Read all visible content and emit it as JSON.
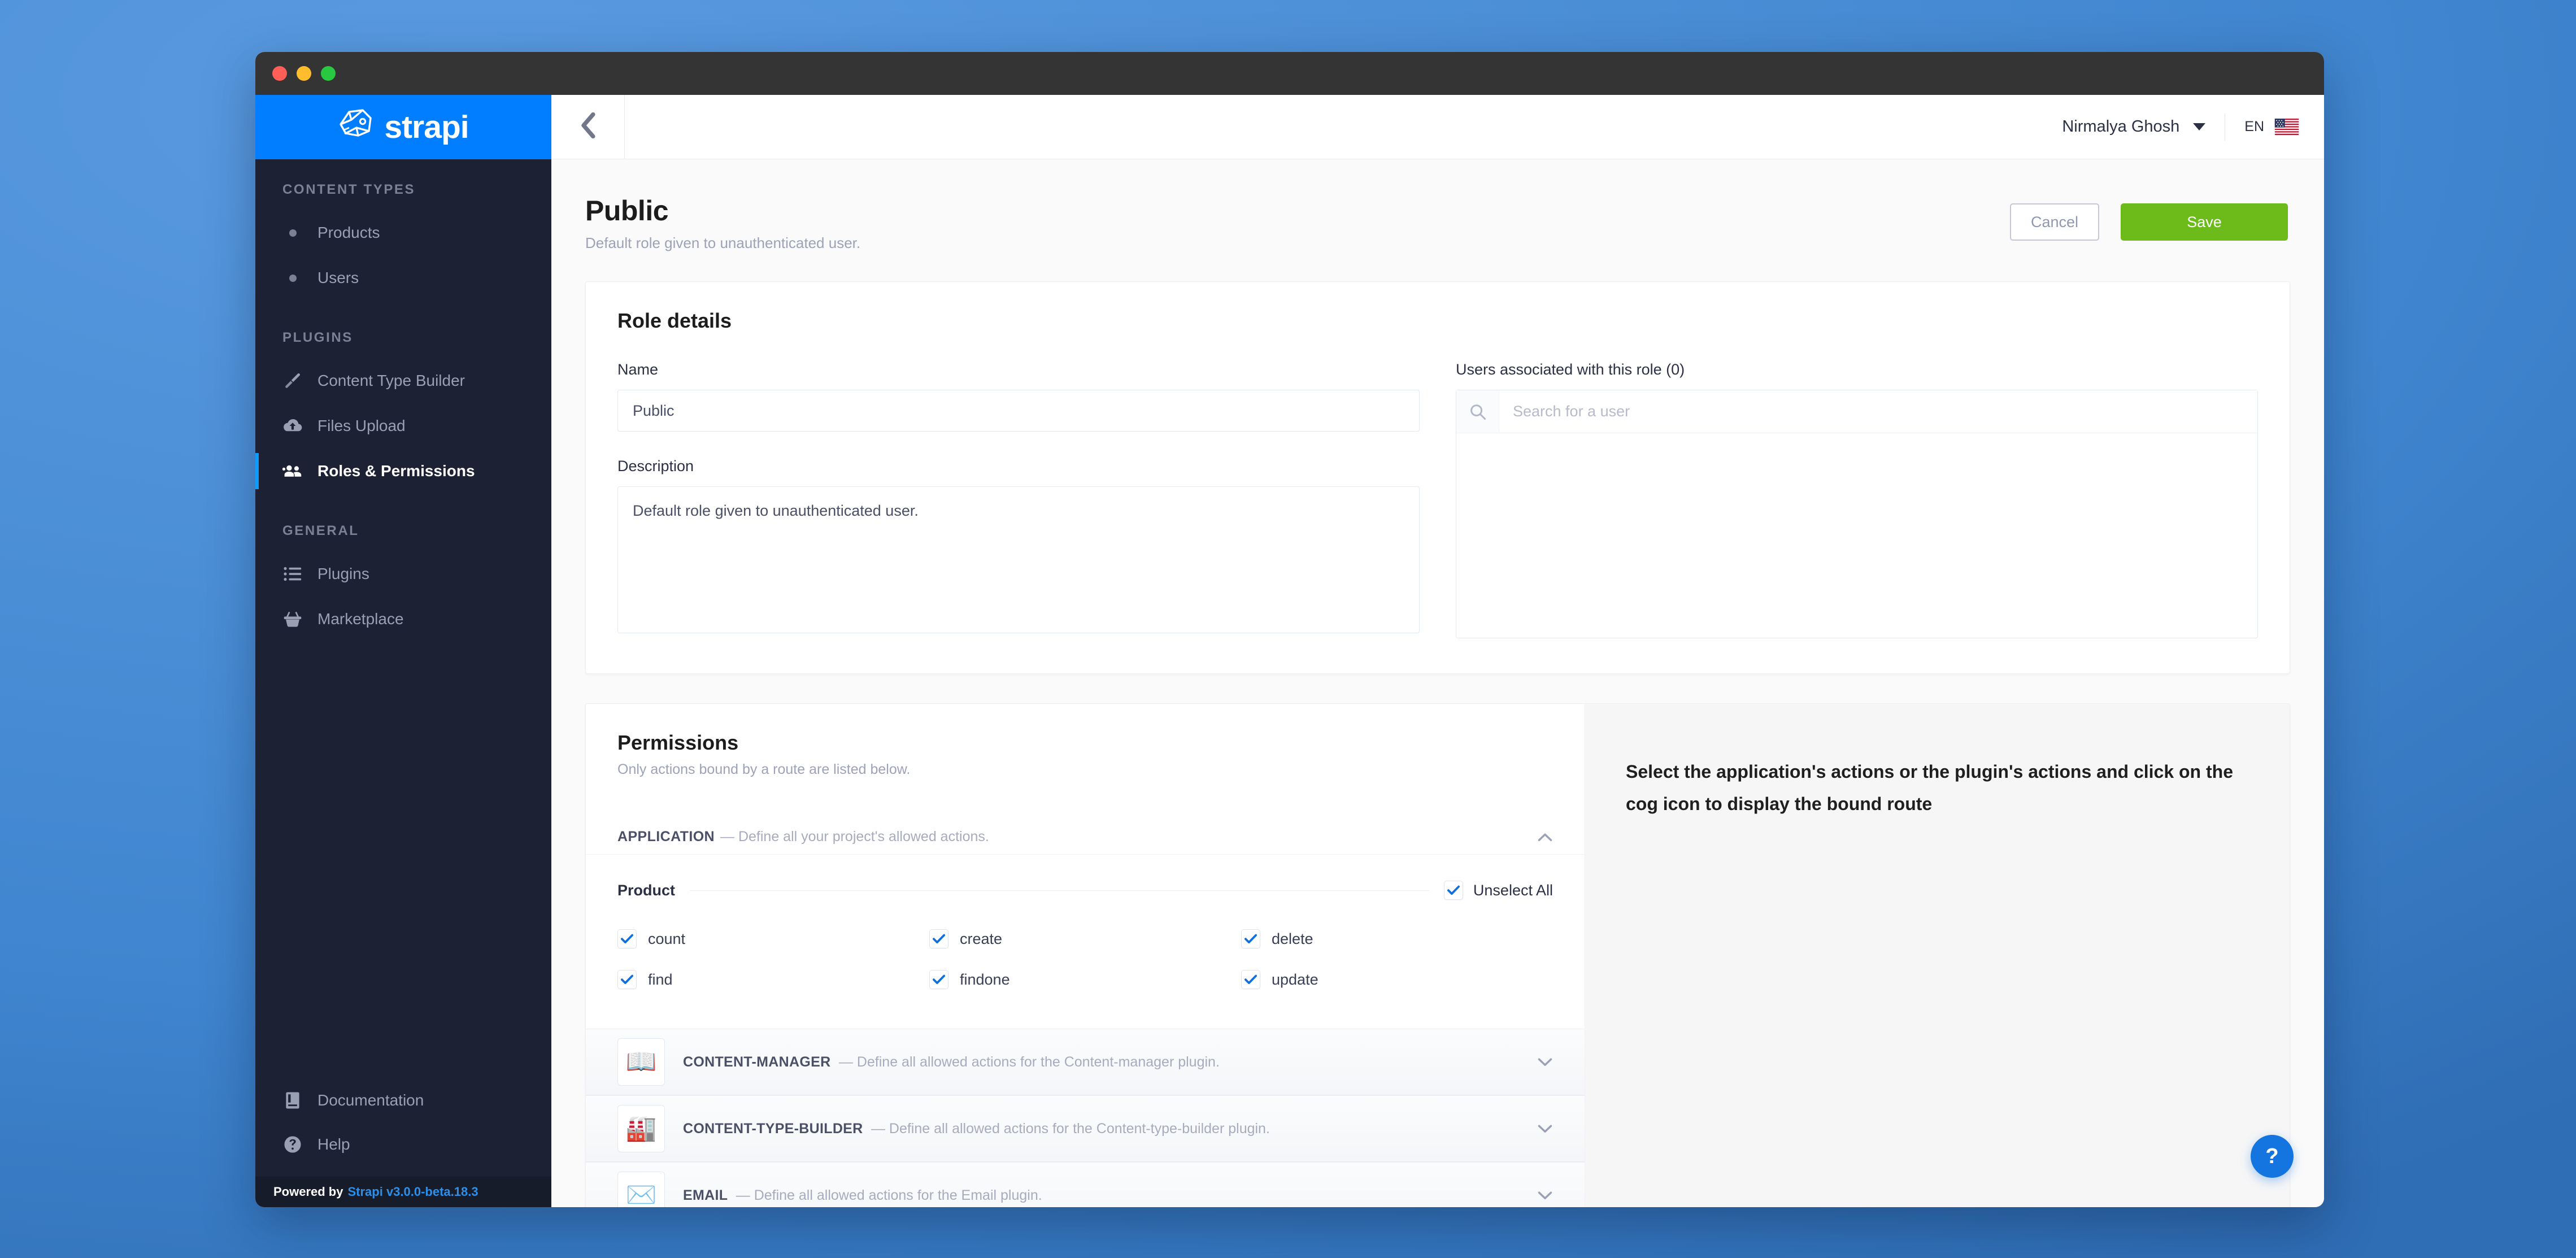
{
  "window": {
    "traffic_lights": [
      "close",
      "minimize",
      "maximize"
    ]
  },
  "brand": {
    "name": "strapi"
  },
  "sidebar": {
    "sections": [
      {
        "title": "CONTENT TYPES",
        "items": [
          {
            "label": "Products",
            "icon": "bullet-icon",
            "active": false
          },
          {
            "label": "Users",
            "icon": "bullet-icon",
            "active": false
          }
        ]
      },
      {
        "title": "PLUGINS",
        "items": [
          {
            "label": "Content Type Builder",
            "icon": "brush-icon",
            "active": false
          },
          {
            "label": "Files Upload",
            "icon": "cloud-upload-icon",
            "active": false
          },
          {
            "label": "Roles & Permissions",
            "icon": "users-group-icon",
            "active": true
          }
        ]
      },
      {
        "title": "GENERAL",
        "items": [
          {
            "label": "Plugins",
            "icon": "list-icon",
            "active": false
          },
          {
            "label": "Marketplace",
            "icon": "basket-icon",
            "active": false
          }
        ]
      }
    ],
    "bottom": [
      {
        "label": "Documentation",
        "icon": "book-icon"
      },
      {
        "label": "Help",
        "icon": "help-circle-icon"
      }
    ],
    "footer": {
      "prefix": "Powered by",
      "link": "Strapi v3.0.0-beta.18.3"
    }
  },
  "topbar": {
    "back_icon": "chevron-left-icon",
    "user_name": "Nirmalya Ghosh",
    "user_caret_icon": "chevron-down-icon",
    "language_code": "EN",
    "language_flag": "us-flag-icon"
  },
  "page": {
    "title": "Public",
    "subtitle": "Default role given to unauthenticated user.",
    "cancel_label": "Cancel",
    "save_label": "Save"
  },
  "role_details": {
    "heading": "Role details",
    "name_label": "Name",
    "name_value": "Public",
    "description_label": "Description",
    "description_value": "Default role given to unauthenticated user.",
    "users_label": "Users associated with this role (0)",
    "users_search_placeholder": "Search for a user",
    "users_search_value": "",
    "search_icon": "search-icon"
  },
  "permissions": {
    "heading": "Permissions",
    "subheading": "Only actions bound by a route are listed below.",
    "application": {
      "name": "APPLICATION",
      "dash": "—",
      "description": "Define all your project's allowed actions.",
      "expanded": true,
      "chevron_icon": "chevron-up-icon"
    },
    "content_type": {
      "name": "Product",
      "toggle_all_label": "Unselect All",
      "toggle_all_checked": true,
      "actions": [
        {
          "label": "count",
          "checked": true
        },
        {
          "label": "create",
          "checked": true
        },
        {
          "label": "delete",
          "checked": true
        },
        {
          "label": "find",
          "checked": true
        },
        {
          "label": "findone",
          "checked": true
        },
        {
          "label": "update",
          "checked": true
        }
      ]
    },
    "plugins": [
      {
        "icon": "open-book-icon",
        "glyph": "📖",
        "name": "CONTENT-MANAGER",
        "dash": "—",
        "description": "Define all allowed actions for the Content-manager plugin.",
        "chevron_icon": "chevron-down-icon"
      },
      {
        "icon": "factory-icon",
        "glyph": "🏭",
        "name": "CONTENT-TYPE-BUILDER",
        "dash": "—",
        "description": "Define all allowed actions for the Content-type-builder plugin.",
        "chevron_icon": "chevron-down-icon"
      },
      {
        "icon": "envelope-icon",
        "glyph": "✉️",
        "name": "EMAIL",
        "dash": "—",
        "description": "Define all allowed actions for the Email plugin.",
        "chevron_icon": "chevron-down-icon"
      }
    ],
    "hint": "Select the application's actions or the plugin's actions and click on the cog icon to display the bound route"
  },
  "help_fab": {
    "label": "?",
    "icon": "question-mark-icon"
  },
  "colors": {
    "brand_blue": "#007eff",
    "sidebar_bg": "#1c2233",
    "save_green": "#6dbb1a",
    "checkbox_blue": "#0f6fde",
    "accent_active": "#0f9bff",
    "desktop_blue": "#4a8ed6"
  }
}
